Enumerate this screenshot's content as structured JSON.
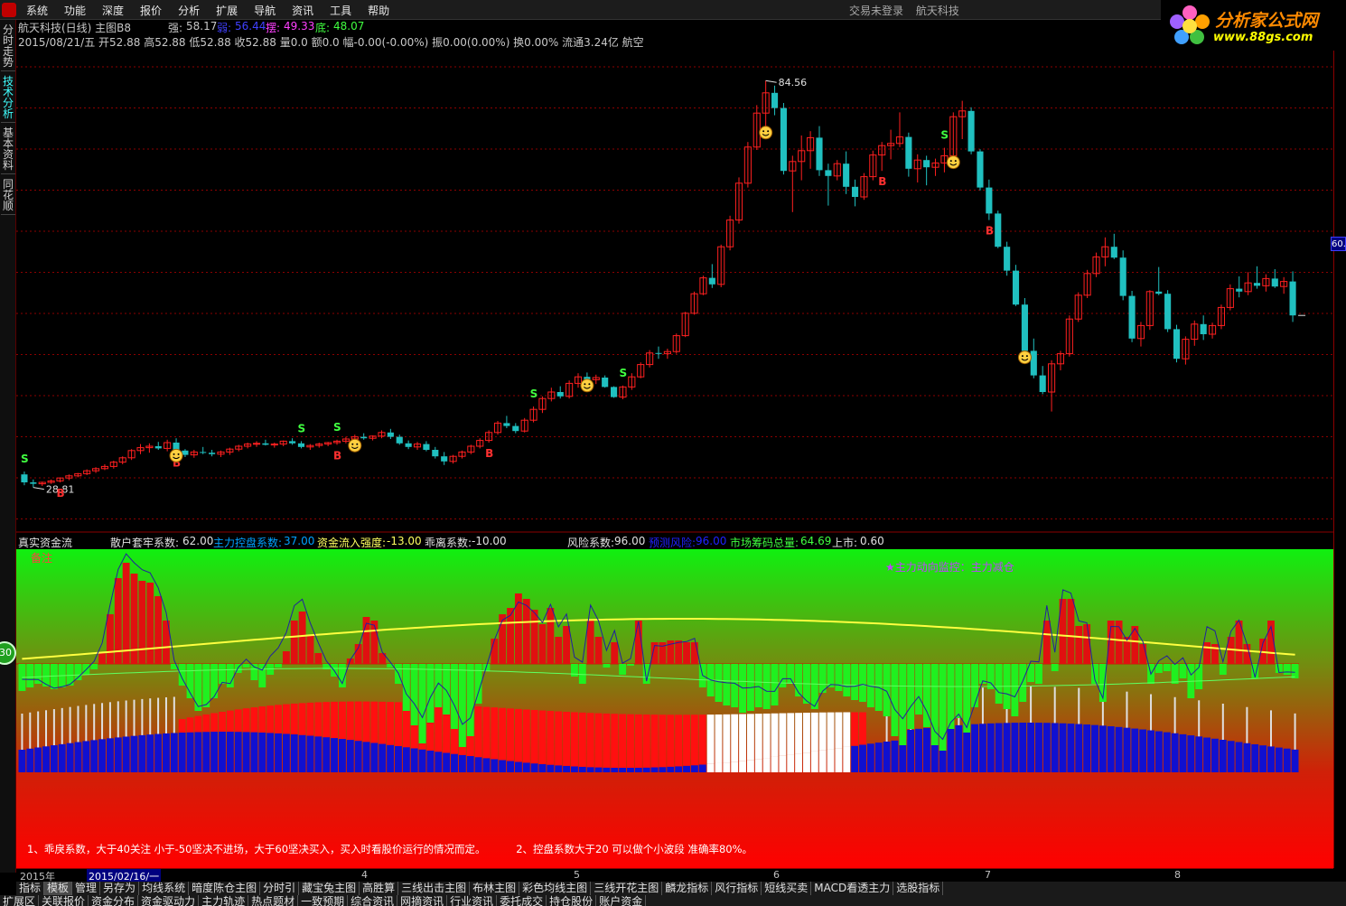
{
  "menu": {
    "items": [
      "系统",
      "功能",
      "深度",
      "报价",
      "分析",
      "扩展",
      "导航",
      "资讯",
      "工具",
      "帮助"
    ],
    "center_status": "交易未登录",
    "center_stock": "航天科技"
  },
  "brand": {
    "name": "分析家公式网",
    "url": "www.88gs.com"
  },
  "left_tabs": [
    "分时走势",
    "技术分析",
    "基本资料",
    "同花顺"
  ],
  "left_tab_active": 1,
  "badge": "30",
  "header": {
    "title": "航天科技(日线) 主图B8",
    "strong_label": "强:",
    "strong_val": "58.17",
    "weak_label": "弱:",
    "weak_val": "56.44",
    "swing_label": "摆:",
    "swing_val": "49.33",
    "bottom_label": "底:",
    "bottom_val": "48.07",
    "line2": "2015/08/21/五 开52.88 高52.88 低52.88 收52.88 量0.0 额0.0 幅-0.00(-0.00%) 振0.00(0.00%) 换0.00% 流通3.24亿 航空"
  },
  "main_chart": {
    "high_label": "84.56",
    "low_label": "28.81",
    "signal_s": "S",
    "signal_b": "B",
    "price_tag": "60.",
    "ohlc": [
      [
        30.1,
        30.5,
        28.6,
        29.0
      ],
      [
        29.0,
        29.4,
        28.3,
        28.8
      ],
      [
        28.8,
        29.1,
        28.5,
        29.0
      ],
      [
        29.0,
        29.4,
        28.8,
        29.2
      ],
      [
        29.2,
        29.7,
        29.0,
        29.6
      ],
      [
        29.6,
        30.1,
        29.3,
        29.9
      ],
      [
        29.9,
        30.3,
        29.7,
        30.2
      ],
      [
        30.2,
        30.8,
        30.0,
        30.6
      ],
      [
        30.6,
        31.1,
        30.3,
        30.9
      ],
      [
        30.9,
        31.5,
        30.7,
        31.2
      ],
      [
        31.2,
        32.0,
        30.9,
        31.8
      ],
      [
        31.8,
        32.6,
        31.5,
        32.4
      ],
      [
        32.4,
        33.6,
        32.1,
        33.4
      ],
      [
        33.4,
        34.3,
        32.9,
        33.8
      ],
      [
        33.8,
        34.4,
        33.1,
        34.0
      ],
      [
        34.0,
        34.6,
        33.5,
        33.7
      ],
      [
        33.7,
        34.9,
        33.3,
        34.5
      ],
      [
        34.5,
        35.1,
        33.2,
        33.4
      ],
      [
        33.4,
        33.6,
        32.5,
        32.8
      ],
      [
        32.8,
        33.5,
        32.4,
        33.2
      ],
      [
        33.2,
        33.9,
        32.9,
        33.1
      ],
      [
        33.1,
        33.5,
        32.6,
        32.9
      ],
      [
        32.9,
        33.4,
        32.5,
        33.2
      ],
      [
        33.2,
        33.8,
        32.8,
        33.6
      ],
      [
        33.6,
        34.2,
        33.3,
        34.0
      ],
      [
        34.0,
        34.5,
        33.7,
        34.3
      ],
      [
        34.3,
        34.7,
        33.9,
        34.4
      ],
      [
        34.4,
        34.9,
        34.1,
        34.2
      ],
      [
        34.2,
        34.5,
        33.8,
        34.3
      ],
      [
        34.3,
        34.8,
        34.0,
        34.7
      ],
      [
        34.7,
        35.1,
        34.2,
        34.4
      ],
      [
        34.4,
        34.7,
        33.7,
        33.9
      ],
      [
        33.9,
        34.3,
        33.5,
        34.1
      ],
      [
        34.1,
        34.5,
        33.8,
        34.3
      ],
      [
        34.3,
        34.6,
        34.0,
        34.5
      ],
      [
        34.5,
        34.9,
        34.2,
        34.7
      ],
      [
        34.7,
        35.3,
        34.4,
        35.0
      ],
      [
        35.0,
        35.6,
        34.6,
        35.3
      ],
      [
        35.3,
        35.8,
        34.9,
        35.1
      ],
      [
        35.1,
        35.5,
        34.8,
        35.4
      ],
      [
        35.4,
        36.2,
        35.1,
        35.9
      ],
      [
        35.9,
        36.4,
        35.0,
        35.3
      ],
      [
        35.3,
        35.6,
        34.2,
        34.4
      ],
      [
        34.4,
        34.8,
        33.6,
        33.9
      ],
      [
        33.9,
        34.6,
        33.5,
        34.3
      ],
      [
        34.3,
        34.7,
        33.3,
        33.5
      ],
      [
        33.5,
        33.9,
        32.3,
        32.6
      ],
      [
        32.6,
        33.2,
        31.4,
        31.9
      ],
      [
        31.9,
        32.8,
        31.6,
        32.6
      ],
      [
        32.6,
        33.4,
        32.3,
        33.2
      ],
      [
        33.2,
        34.2,
        32.9,
        34.0
      ],
      [
        34.0,
        35.1,
        33.7,
        34.8
      ],
      [
        34.8,
        36.2,
        34.5,
        35.9
      ],
      [
        35.9,
        37.5,
        35.6,
        37.2
      ],
      [
        37.2,
        38.2,
        36.5,
        36.8
      ],
      [
        36.8,
        37.2,
        35.8,
        36.1
      ],
      [
        36.1,
        37.9,
        35.9,
        37.6
      ],
      [
        37.6,
        39.5,
        37.3,
        39.1
      ],
      [
        39.1,
        40.9,
        38.6,
        40.6
      ],
      [
        40.6,
        42.1,
        40.2,
        41.5
      ],
      [
        41.5,
        42.3,
        40.6,
        40.9
      ],
      [
        40.9,
        43.1,
        40.6,
        42.7
      ],
      [
        42.7,
        44.1,
        42.1,
        43.6
      ],
      [
        43.6,
        44.2,
        42.9,
        43.2
      ],
      [
        43.2,
        43.9,
        42.6,
        43.5
      ],
      [
        43.5,
        43.8,
        42.1,
        42.2
      ],
      [
        42.2,
        42.3,
        40.7,
        40.8
      ],
      [
        40.8,
        42.4,
        40.5,
        42.2
      ],
      [
        42.2,
        44.1,
        41.8,
        43.6
      ],
      [
        43.6,
        45.6,
        43.4,
        45.3
      ],
      [
        45.3,
        47.3,
        44.9,
        46.9
      ],
      [
        46.9,
        47.8,
        46.1,
        46.8
      ],
      [
        46.8,
        47.5,
        46.1,
        47.1
      ],
      [
        47.1,
        49.6,
        46.8,
        49.3
      ],
      [
        49.3,
        52.6,
        49.1,
        52.4
      ],
      [
        52.4,
        55.4,
        52.2,
        55.1
      ],
      [
        55.1,
        57.6,
        54.9,
        57.3
      ],
      [
        57.3,
        59.2,
        55.9,
        56.4
      ],
      [
        56.4,
        61.9,
        56.0,
        61.6
      ],
      [
        61.6,
        65.9,
        61.1,
        65.3
      ],
      [
        65.3,
        71.2,
        64.8,
        70.4
      ],
      [
        70.4,
        76.1,
        69.8,
        75.4
      ],
      [
        75.4,
        81.2,
        75.0,
        80.1
      ],
      [
        80.1,
        84.6,
        77.9,
        82.9
      ],
      [
        82.9,
        83.9,
        79.8,
        80.8
      ],
      [
        80.8,
        81.5,
        71.6,
        72.1
      ],
      [
        72.1,
        74.2,
        66.4,
        73.4
      ],
      [
        73.4,
        77.0,
        70.8,
        74.9
      ],
      [
        74.9,
        77.6,
        72.4,
        76.7
      ],
      [
        76.7,
        78.3,
        71.4,
        72.2
      ],
      [
        72.2,
        73.1,
        67.3,
        71.4
      ],
      [
        71.4,
        73.6,
        70.8,
        73.1
      ],
      [
        73.1,
        74.8,
        68.9,
        69.9
      ],
      [
        69.9,
        70.9,
        67.2,
        68.5
      ],
      [
        68.5,
        71.8,
        68.1,
        71.3
      ],
      [
        71.3,
        74.9,
        70.8,
        74.3
      ],
      [
        74.3,
        76.1,
        72.1,
        75.6
      ],
      [
        75.6,
        77.8,
        73.7,
        75.9
      ],
      [
        75.9,
        80.2,
        75.4,
        76.8
      ],
      [
        76.8,
        77.4,
        71.3,
        72.4
      ],
      [
        72.4,
        74.4,
        70.5,
        73.6
      ],
      [
        73.6,
        74.2,
        70.1,
        72.6
      ],
      [
        72.6,
        73.8,
        71.4,
        73.2
      ],
      [
        73.2,
        75.3,
        71.9,
        74.2
      ],
      [
        74.2,
        80.2,
        73.8,
        79.6
      ],
      [
        79.6,
        81.8,
        76.5,
        80.4
      ],
      [
        80.4,
        80.9,
        74.4,
        74.8
      ],
      [
        74.8,
        75.1,
        69.4,
        69.8
      ],
      [
        69.8,
        70.9,
        65.3,
        66.2
      ],
      [
        66.2,
        66.6,
        61.4,
        61.6
      ],
      [
        61.6,
        62.3,
        57.6,
        58.3
      ],
      [
        58.3,
        59.1,
        53.4,
        53.6
      ],
      [
        53.6,
        54.5,
        46.8,
        47.2
      ],
      [
        47.2,
        48.9,
        43.4,
        43.8
      ],
      [
        43.8,
        45.1,
        41.2,
        41.5
      ],
      [
        41.5,
        45.9,
        38.8,
        45.4
      ],
      [
        45.4,
        47.2,
        44.5,
        46.8
      ],
      [
        46.8,
        52.1,
        46.4,
        51.6
      ],
      [
        51.6,
        55.3,
        51.2,
        54.9
      ],
      [
        54.9,
        58.4,
        54.5,
        57.9
      ],
      [
        57.9,
        60.8,
        57.4,
        60.2
      ],
      [
        60.2,
        62.9,
        58.9,
        61.6
      ],
      [
        61.6,
        63.4,
        59.9,
        60.1
      ],
      [
        60.1,
        61.1,
        54.2,
        54.8
      ],
      [
        54.8,
        55.5,
        48.4,
        48.9
      ],
      [
        48.9,
        51.2,
        47.8,
        50.7
      ],
      [
        50.7,
        55.6,
        50.1,
        55.4
      ],
      [
        55.4,
        58.8,
        54.9,
        55.1
      ],
      [
        55.1,
        55.6,
        49.8,
        50.2
      ],
      [
        50.2,
        50.8,
        45.6,
        46.1
      ],
      [
        46.1,
        49.2,
        45.3,
        48.8
      ],
      [
        48.8,
        51.4,
        47.9,
        50.9
      ],
      [
        50.9,
        52.1,
        48.7,
        49.5
      ],
      [
        49.5,
        51.1,
        48.9,
        50.7
      ],
      [
        50.7,
        53.6,
        50.2,
        53.2
      ],
      [
        53.2,
        56.4,
        52.8,
        55.8
      ],
      [
        55.8,
        57.5,
        54.6,
        55.4
      ],
      [
        55.4,
        58.1,
        54.9,
        56.6
      ],
      [
        56.6,
        58.9,
        55.8,
        56.2
      ],
      [
        56.2,
        57.8,
        55.4,
        57.2
      ],
      [
        57.2,
        58.5,
        55.9,
        56.1
      ],
      [
        56.1,
        57.4,
        55.1,
        56.8
      ],
      [
        56.8,
        58.2,
        51.2,
        52.1
      ]
    ],
    "s_signals": [
      0,
      31,
      35,
      57,
      67,
      103
    ],
    "b_signals": [
      4,
      17,
      35,
      52,
      96,
      108
    ],
    "smiles": [
      17,
      37,
      63,
      83,
      104,
      112
    ]
  },
  "sub_header": {
    "name": "真实资金流",
    "f1_label": "散户套牢系数:",
    "f1_val": "62.00",
    "f2_label": "主力控盘系数:",
    "f2_val": "37.00",
    "f3_label": "资金流入强度:",
    "f3_val": "-13.00",
    "f4_label": "乖离系数:",
    "f4_val": "-10.00",
    "f5_label": "风险系数:",
    "f5_val": "96.00",
    "f6_label": "预测风险:",
    "f6_val": "96.00",
    "f7_label": "市场筹码总量:",
    "f7_val": "64.69",
    "f8_label": "上市:",
    "f8_val": "0.60"
  },
  "sub_chart": {
    "beizhu": "备注",
    "monitor": "★主力动向监控：主力减仓",
    "note1": "1、乖戾系数，大于40关注 小于-50坚决不进场，大于60坚决买入，买入时看股价运行的情况而定。",
    "note2": "2、控盘系数大于20 可以做个小波段 准确率80%。",
    "top_bars": [
      -30,
      -26,
      -22,
      -25,
      -28,
      -26,
      -24,
      -18,
      -12,
      -6,
      12,
      55,
      95,
      112,
      100,
      92,
      90,
      75,
      48,
      -6,
      -24,
      -38,
      -52,
      -48,
      -38,
      -22,
      -26,
      -10,
      -4,
      -18,
      -26,
      -12,
      -4,
      14,
      48,
      58,
      32,
      12,
      -6,
      -14,
      -26,
      6,
      22,
      52,
      48,
      12,
      -4,
      -22,
      -52,
      -68,
      -88,
      -65,
      -48,
      -56,
      -72,
      -92,
      -80,
      -44,
      -8,
      28,
      55,
      62,
      78,
      72,
      60,
      44,
      62,
      30,
      42,
      -14,
      -22,
      48,
      30,
      -4,
      24,
      -12,
      -2,
      48,
      -22,
      24,
      24,
      26,
      26,
      24,
      24,
      -26,
      -36,
      -42,
      -46,
      -48,
      -54,
      -52,
      -48,
      -50,
      -46,
      -26,
      -22,
      -36,
      -44,
      -50,
      -32,
      -26,
      -30,
      -36,
      -40,
      -42,
      -48,
      -52,
      -58,
      -80,
      -90,
      -72,
      -56,
      -70,
      -90,
      -96,
      -72,
      -60,
      -76,
      -48,
      -22,
      -28,
      -44,
      -50,
      -58,
      -42,
      -20,
      -22,
      48,
      -8,
      72,
      72,
      42,
      44,
      -22,
      -42,
      48,
      48,
      30,
      42,
      22,
      -22,
      -10,
      -8,
      -22,
      -16,
      -38,
      -28,
      24,
      22,
      -12,
      30,
      48,
      22,
      -16,
      28,
      48,
      -10,
      -12,
      -16
    ]
  },
  "axis": {
    "year": "2015年",
    "selected_date": "2015/02/16/一",
    "months": [
      "4",
      "5",
      "6",
      "7",
      "8"
    ]
  },
  "tabs1": [
    "指标",
    "模板",
    "管理",
    "另存为",
    "均线系统",
    "暗度陈仓主图",
    "分时引",
    "藏宝兔主图",
    "高胜算",
    "三线出击主图",
    "布林主图",
    "彩色均线主图",
    "三线开花主图",
    "麟龙指标",
    "风行指标",
    "短线买卖",
    "MACD看透主力",
    "选股指标"
  ],
  "tabs1_active": 1,
  "tabs2": [
    "扩展区",
    "关联报价",
    "资金分布",
    "资金驱动力",
    "主力轨迹",
    "热点题材",
    "一致预期",
    "综合资讯",
    "网摘资讯",
    "行业资讯",
    "委托成交",
    "持仓股份",
    "账户资金"
  ],
  "colors": {
    "up": "#ff2020",
    "down": "#20c0c0",
    "grid": "#8b0000",
    "strong": "#ffff00",
    "weak": "#4040ff",
    "swing": "#ff40ff",
    "bottom": "#40ff40"
  }
}
